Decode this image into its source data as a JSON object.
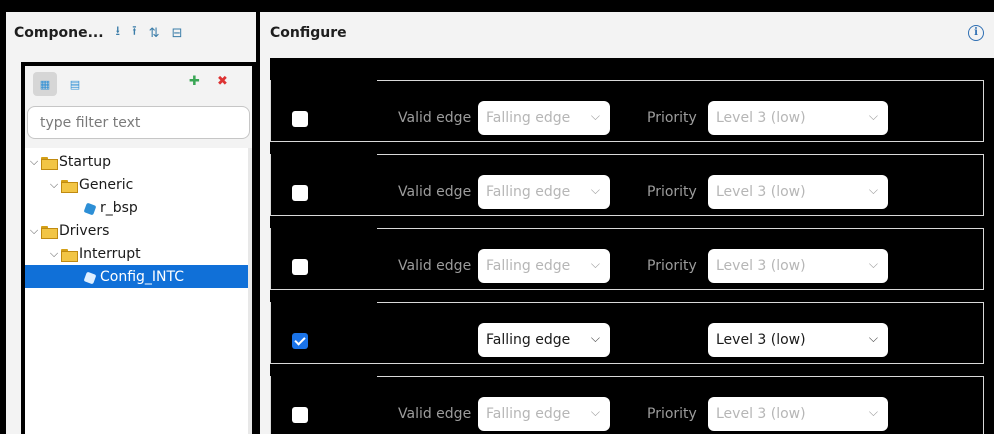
{
  "components_panel": {
    "title": "Compone...",
    "filter_placeholder": "type filter text",
    "tree": [
      {
        "label": "Startup",
        "type": "folder",
        "level": 0
      },
      {
        "label": "Generic",
        "type": "folder",
        "level": 1
      },
      {
        "label": "r_bsp",
        "type": "component",
        "level": 2
      },
      {
        "label": "Drivers",
        "type": "folder",
        "level": 0
      },
      {
        "label": "Interrupt",
        "type": "folder",
        "level": 1
      },
      {
        "label": "Config_INTC",
        "type": "component",
        "level": 2,
        "selected": true
      }
    ]
  },
  "configure_panel": {
    "title": "Configure",
    "rows": [
      {
        "checked": false,
        "edge_label": "Valid edge",
        "edge_value": "Falling edge",
        "priority_label": "Priority",
        "priority_value": "Level 3 (low)"
      },
      {
        "checked": false,
        "edge_label": "Valid edge",
        "edge_value": "Falling edge",
        "priority_label": "Priority",
        "priority_value": "Level 3 (low)"
      },
      {
        "checked": false,
        "edge_label": "Valid edge",
        "edge_value": "Falling edge",
        "priority_label": "Priority",
        "priority_value": "Level 3 (low)"
      },
      {
        "checked": true,
        "edge_label": "",
        "edge_value": "Falling edge",
        "priority_label": "",
        "priority_value": "Level 3 (low)"
      },
      {
        "checked": false,
        "edge_label": "Valid edge",
        "edge_value": "Falling edge",
        "priority_label": "Priority",
        "priority_value": "Level 3 (low)"
      }
    ]
  },
  "colors": {
    "accent": "#1070d8",
    "checkbox_on": "#1a73e8",
    "folder": "#f2c545"
  }
}
